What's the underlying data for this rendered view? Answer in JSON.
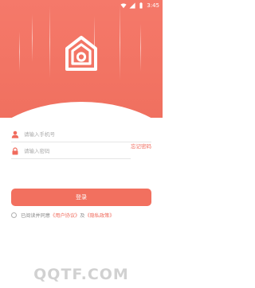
{
  "status_bar": {
    "time": "3:45"
  },
  "login": {
    "phone_placeholder": "请输入手机号",
    "password_placeholder": "请输入密码",
    "forgot_label": "忘记密码",
    "submit_label": "登录"
  },
  "agreement": {
    "prefix": "已阅读并同意",
    "user_agreement": "《用户协议》",
    "and": "及",
    "privacy_policy": "《隐私政策》"
  },
  "watermark": {
    "text": "QQTF.COM"
  },
  "colors": {
    "brand": "#f2705f",
    "link": "#f06b5d"
  },
  "icons": {
    "phone": "user-icon",
    "password": "lock-icon",
    "logo": "home-camera-icon"
  }
}
